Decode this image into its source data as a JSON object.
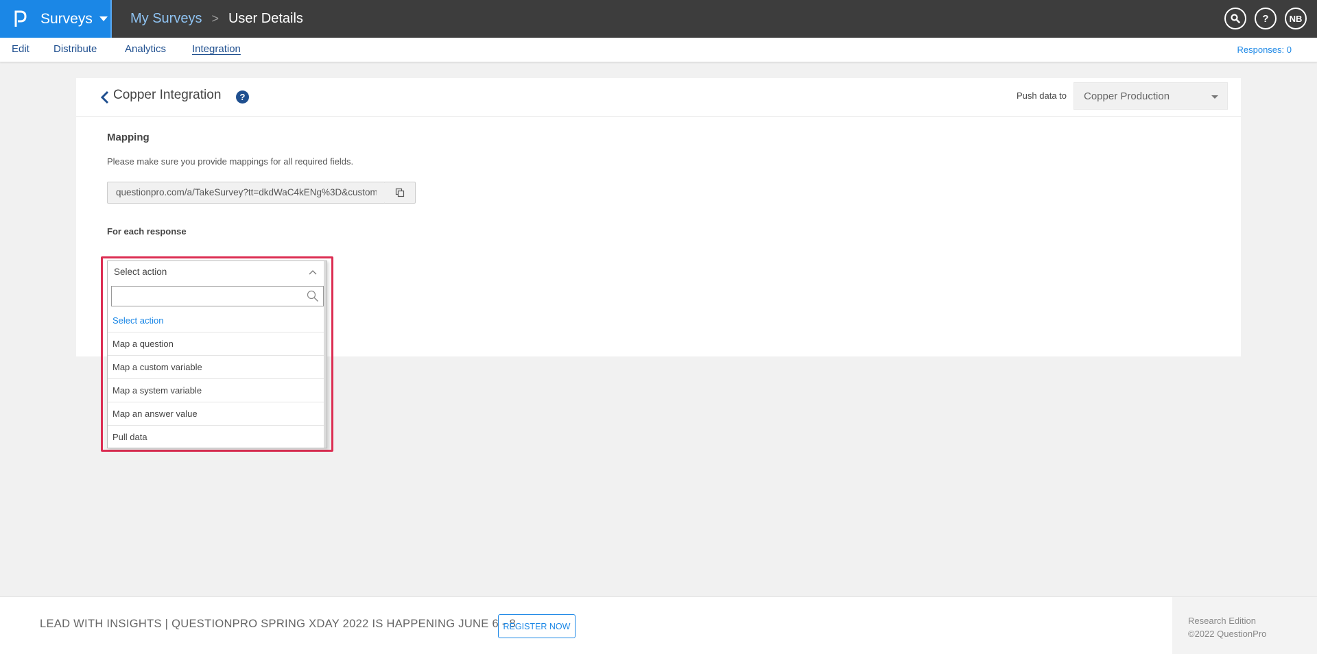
{
  "brand": {
    "name": "Surveys"
  },
  "breadcrumb": {
    "parent": "My Surveys",
    "separator": ">",
    "current": "User Details"
  },
  "top_icons": {
    "search": "search-icon",
    "help": "?",
    "avatar_initials": "NB"
  },
  "subnav": {
    "tabs": [
      {
        "label": "Edit"
      },
      {
        "label": "Distribute"
      },
      {
        "label": "Analytics"
      },
      {
        "label": "Integration",
        "active": true
      }
    ],
    "responses": "Responses: 0"
  },
  "card": {
    "title": "Copper Integration",
    "help": "?",
    "push_label": "Push data to",
    "push_value": "Copper Production"
  },
  "mapping": {
    "title": "Mapping",
    "hint": "Please make sure you provide mappings for all required fields.",
    "url": "questionpro.com/a/TakeSurvey?tt=dkdWaC4kENg%3D&custom",
    "for_each": "For each response"
  },
  "action_dropdown": {
    "selected": "Select action",
    "search_placeholder": "",
    "options": [
      "Select action",
      "Map a question",
      "Map a custom variable",
      "Map a system variable",
      "Map an answer value",
      "Pull data"
    ]
  },
  "footer": {
    "promo": "LEAD WITH INSIGHTS | QUESTIONPRO SPRING XDAY 2022 IS HAPPENING JUNE 6 - 8",
    "register": "REGISTER NOW",
    "edition": "Research Edition",
    "copyright": "©2022 QuestionPro"
  },
  "colors": {
    "brand_blue": "#1b87e6",
    "topbar": "#3d3d3d",
    "highlight": "#dc2d52",
    "nav_text": "#1f4f8f"
  }
}
